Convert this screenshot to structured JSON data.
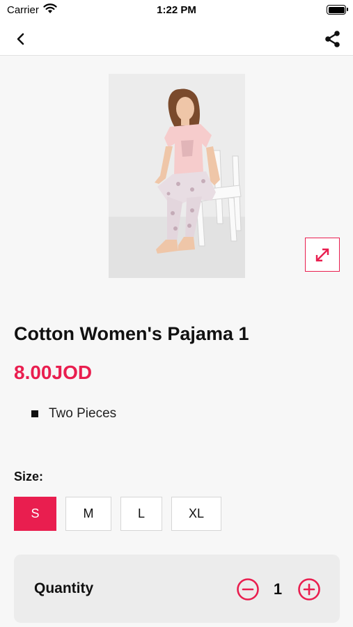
{
  "status_bar": {
    "carrier": "Carrier",
    "time": "1:22 PM"
  },
  "nav": {
    "back_icon": "chevron-left-icon",
    "share_icon": "share-icon"
  },
  "product": {
    "image_alt": "woman in pink pajama seated on a white chair",
    "expand_icon": "expand-icon",
    "title": "Cotton Women's Pajama 1",
    "price": "8.00JOD",
    "features": [
      "Two Pieces"
    ]
  },
  "size": {
    "label": "Size:",
    "options": [
      "S",
      "M",
      "L",
      "XL"
    ],
    "selected": "S"
  },
  "quantity": {
    "label": "Quantity",
    "value": "1"
  },
  "colors": {
    "accent": "#e91e4f",
    "background": "#f7f7f7",
    "card": "#ececec"
  }
}
